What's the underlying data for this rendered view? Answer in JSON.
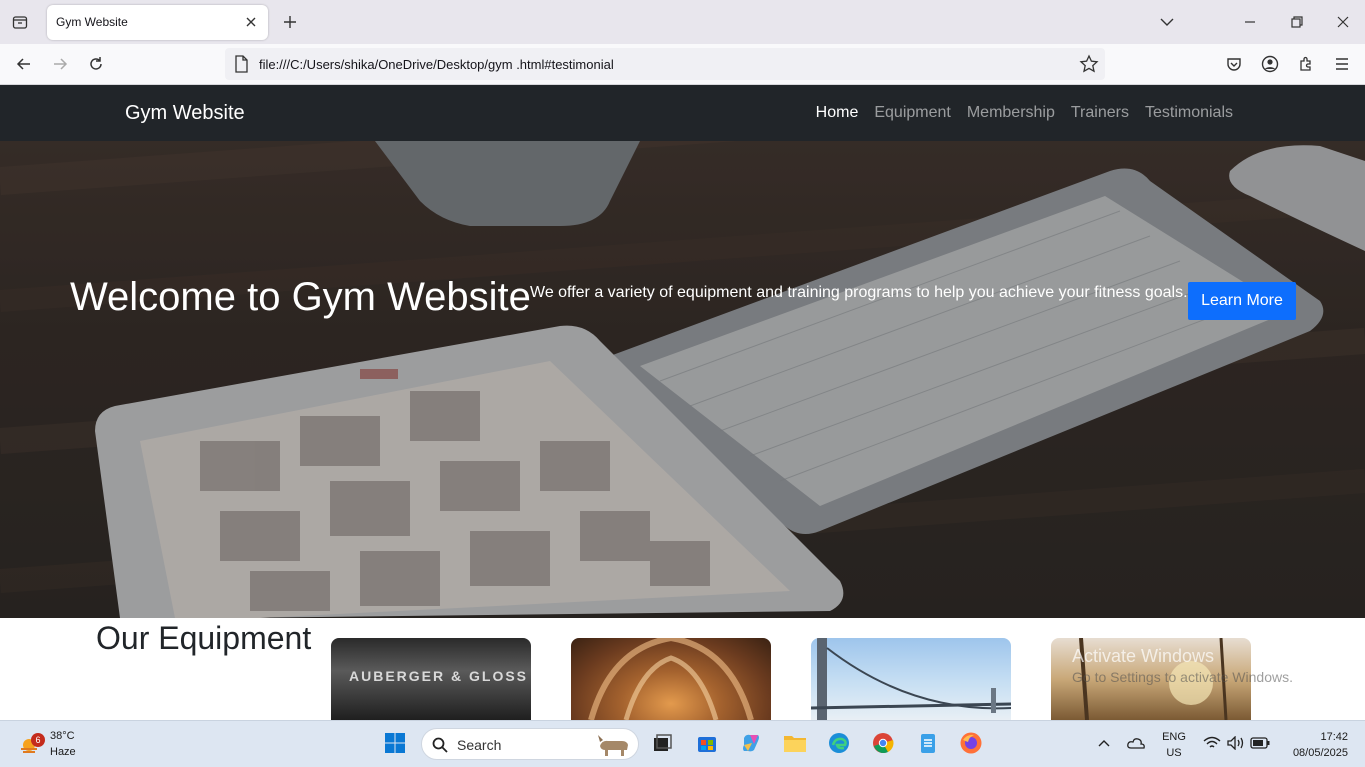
{
  "browser": {
    "tab_title": "Gym Website",
    "url": "file:///C:/Users/shika/OneDrive/Desktop/gym .html#testimonial"
  },
  "site": {
    "brand": "Gym Website",
    "menu": [
      {
        "label": "Home"
      },
      {
        "label": "Equipment"
      },
      {
        "label": "Membership"
      },
      {
        "label": "Trainers"
      },
      {
        "label": "Testimonials"
      }
    ]
  },
  "hero": {
    "title": "Welcome to Gym Website",
    "subtitle": "We offer a variety of equipment and training programs to help you achieve your fitness goals.",
    "button": "Learn More"
  },
  "equipment": {
    "title": "Our Equipment",
    "card1_text": "AUBERGER & GLOSS"
  },
  "watermark": {
    "line1": "Activate Windows",
    "line2": "Go to Settings to activate Windows."
  },
  "taskbar": {
    "weather_badge": "6",
    "weather_temp": "38°C",
    "weather_desc": "Haze",
    "search_label": "Search",
    "lang_top": "ENG",
    "lang_bottom": "US",
    "time": "17:42",
    "date": "08/05/2025"
  },
  "colors": {
    "nav_bg": "#212529",
    "primary_button": "#0d6efd"
  }
}
